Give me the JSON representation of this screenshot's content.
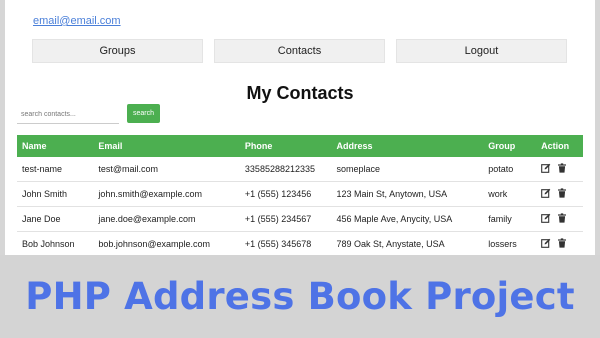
{
  "header": {
    "user_email": "email@email.com"
  },
  "nav": {
    "items": [
      {
        "label": "Groups"
      },
      {
        "label": "Contacts"
      },
      {
        "label": "Logout"
      }
    ]
  },
  "main": {
    "title": "My Contacts",
    "search": {
      "placeholder": "search contacts...",
      "button_label": "search"
    },
    "table": {
      "columns": [
        "Name",
        "Email",
        "Phone",
        "Address",
        "Group",
        "Action"
      ],
      "rows": [
        {
          "name": "test-name",
          "email": "test@mail.com",
          "phone": "33585288212335",
          "address": "someplace",
          "group": "potato"
        },
        {
          "name": "John Smith",
          "email": "john.smith@example.com",
          "phone": "+1 (555) 123456",
          "address": "123 Main St, Anytown, USA",
          "group": "work"
        },
        {
          "name": "Jane Doe",
          "email": "jane.doe@example.com",
          "phone": "+1 (555) 234567",
          "address": "456 Maple Ave, Anycity, USA",
          "group": "family"
        },
        {
          "name": "Bob Johnson",
          "email": "bob.johnson@example.com",
          "phone": "+1 (555) 345678",
          "address": "789 Oak St, Anystate, USA",
          "group": "lossers"
        }
      ],
      "action_icons": [
        "edit-icon",
        "trash-icon"
      ]
    }
  },
  "banner": {
    "text": "PHP Address Book Project"
  },
  "colors": {
    "accent": "#4caf50",
    "banner_text": "#4e73e6",
    "link": "#4a7fd9"
  }
}
